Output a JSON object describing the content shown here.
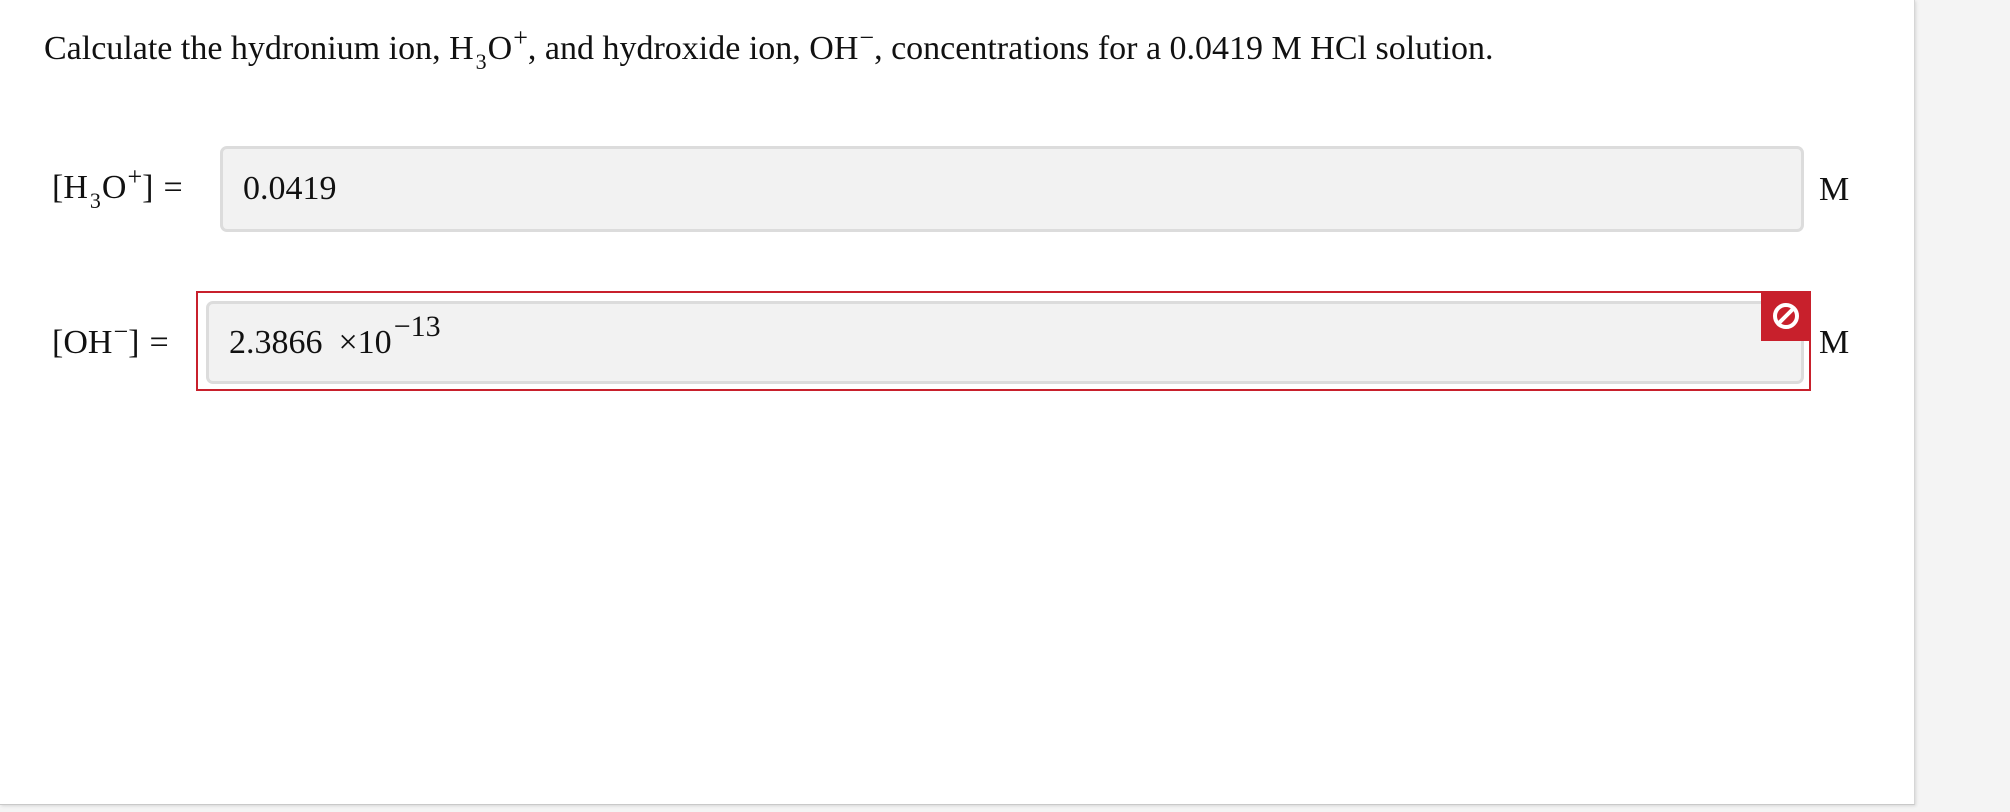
{
  "question": {
    "prefix": "Calculate the hydronium ion, ",
    "hydronium_h": "H",
    "hydronium_sub": "3",
    "hydronium_o": "O",
    "hydronium_charge": "+",
    "middle": ", and hydroxide ion, ",
    "hydroxide": "OH",
    "hydroxide_charge": "−",
    "suffix": ", concentrations for a 0.0419 M HCl solution."
  },
  "rows": [
    {
      "label_open": "[H",
      "label_sub": "3",
      "label_o": "O",
      "label_charge": "+",
      "label_close": "]",
      "equals": "=",
      "value": "0.0419",
      "unit": "M"
    },
    {
      "label_open": "[OH",
      "label_charge": "−",
      "label_close": "]",
      "equals": "=",
      "mantissa": "2.3866",
      "times": "×10",
      "exponent": "−13",
      "unit": "M",
      "status": "incorrect"
    }
  ],
  "colors": {
    "error": "#c8202c",
    "input_bg": "#f2f2f2",
    "input_border": "#dcdcdc"
  },
  "icons": {
    "error_icon": "prohibited-icon"
  }
}
